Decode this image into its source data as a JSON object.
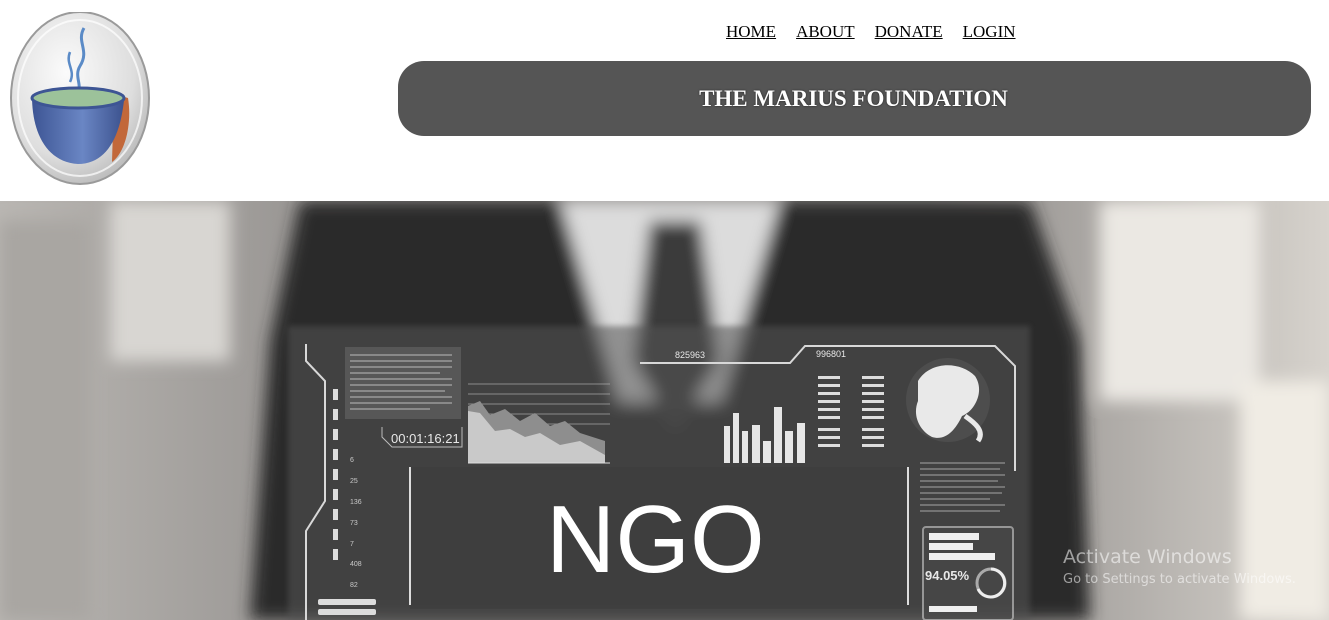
{
  "nav": {
    "items": [
      {
        "label": "HOME"
      },
      {
        "label": "ABOUT"
      },
      {
        "label": "DONATE"
      },
      {
        "label": "LOGIN"
      }
    ]
  },
  "header": {
    "title": "THE MARIUS FOUNDATION"
  },
  "hero": {
    "headline": "NGO",
    "timer": "00:01:16:21",
    "code_a": "825963",
    "code_b": "996801",
    "percent": "94.05%",
    "scale_ticks": [
      "6",
      "25",
      "136",
      "73",
      "7",
      "408",
      "82"
    ]
  },
  "watermark": {
    "line1": "Activate Windows",
    "line2": "Go to Settings to activate Windows."
  },
  "colors": {
    "title_bar": "#555555",
    "title_text": "#ffffff",
    "cup_blue": "#4f6aa8",
    "steam_blue": "#5b8bc7"
  }
}
